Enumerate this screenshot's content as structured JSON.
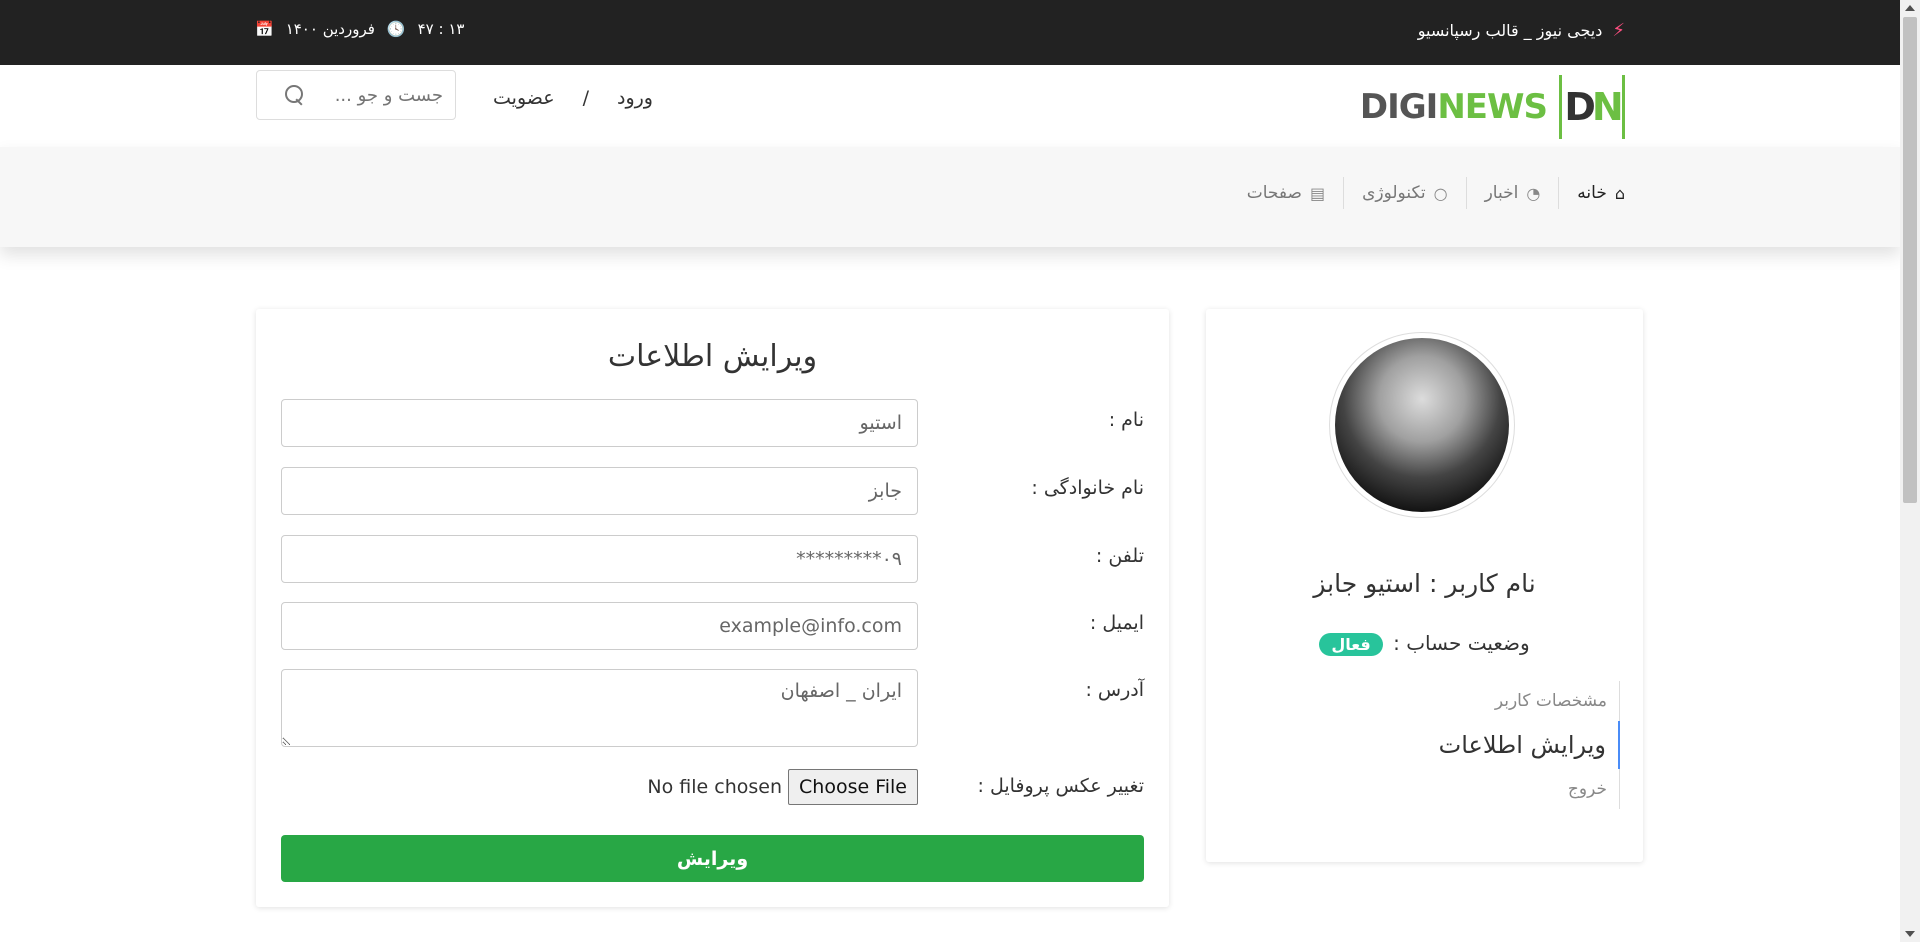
{
  "topbar": {
    "brand_text": "دیجی نیوز _ قالب رسپانسیو",
    "date": "فروردین ۱۴۰۰",
    "time": "۱۳ : ۴۷"
  },
  "header": {
    "logo_digi": "DIGI",
    "logo_news": "NEWS",
    "logo_d": "D",
    "logo_n": "N",
    "login": "ورود",
    "separator": "/",
    "register": "عضویت",
    "search_placeholder": "جست و جو ..."
  },
  "nav": {
    "items": [
      {
        "label": "خانه",
        "icon": "home-icon"
      },
      {
        "label": "اخبار",
        "icon": "rss-icon"
      },
      {
        "label": "تکنولوژی",
        "icon": "circle-notch-icon"
      },
      {
        "label": "صفحات",
        "icon": "file-icon"
      }
    ]
  },
  "form": {
    "title": "ویرایش اطلاعات",
    "first_name_label": "نام :",
    "first_name_value": "استیو",
    "last_name_label": "نام خانوادگی :",
    "last_name_value": "جابز",
    "phone_label": "تلفن :",
    "phone_value": "۰۹*********",
    "email_label": "ایمیل :",
    "email_value": "example@info.com",
    "address_label": "آدرس :",
    "address_value": "ایران _ اصفهان",
    "photo_label": "تغییر عکس پروفایل :",
    "choose_file": "Choose File",
    "no_file": "No file chosen",
    "submit": "ویرایش"
  },
  "profile": {
    "username": "نام کاربر : استیو جابز",
    "status_label": "وضعیت حساب :",
    "status_badge": "فعال",
    "menu": [
      "مشخصات کاربر",
      "ویرایش اطلاعات",
      "خروج"
    ]
  },
  "colors": {
    "topbar": "#222222",
    "accent_green": "#28a745",
    "badge": "#28c49b",
    "logo_green": "#6cbf43",
    "active_menu_border": "#4a8cf7"
  }
}
